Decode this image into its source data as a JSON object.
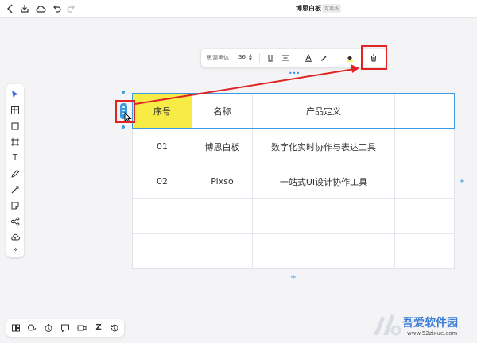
{
  "topbar": {
    "title": "博思白板",
    "badge": "可离线",
    "icons": [
      "back-icon",
      "save-download-icon",
      "cloud-icon",
      "undo-icon",
      "redo-icon"
    ]
  },
  "left_toolbar": {
    "items": [
      {
        "name": "select-tool",
        "icon": "cursor-icon"
      },
      {
        "name": "table-tool",
        "icon": "table-icon"
      },
      {
        "name": "rectangle-tool",
        "icon": "square-icon"
      },
      {
        "name": "frame-tool",
        "icon": "frame-icon"
      },
      {
        "name": "text-tool",
        "icon": "text-icon",
        "glyph": "T"
      },
      {
        "name": "pen-tool",
        "icon": "pen-icon"
      },
      {
        "name": "line-tool",
        "icon": "line-icon"
      },
      {
        "name": "sticky-note-tool",
        "icon": "sticky-note-icon"
      },
      {
        "name": "mindmap-tool",
        "icon": "mindmap-icon"
      },
      {
        "name": "upload-tool",
        "icon": "upload-icon"
      },
      {
        "name": "more-tool",
        "icon": "more-icon",
        "glyph": "»"
      }
    ]
  },
  "bottom_toolbar": {
    "items": [
      {
        "name": "layout-button",
        "icon": "layout-icon"
      },
      {
        "name": "chat-button",
        "icon": "chat-icon"
      },
      {
        "name": "timer-button",
        "icon": "timer-icon"
      },
      {
        "name": "comment-button",
        "icon": "comment-icon"
      },
      {
        "name": "video-button",
        "icon": "video-icon"
      },
      {
        "name": "sleep-button",
        "icon": "z-icon",
        "glyph": "Z"
      },
      {
        "name": "history-button",
        "icon": "history-icon"
      }
    ]
  },
  "float_toolbar": {
    "font_name": "思源黑体",
    "font_size": "36",
    "stepper_up": "▲",
    "stepper_down": "▼",
    "icons": [
      "text-style-icon",
      "align-icon",
      "text-color-icon",
      "highlight-icon",
      "fill-color-icon",
      "delete-icon"
    ],
    "more_handle": "•••",
    "fill_color": "#f7ec45"
  },
  "table": {
    "header_fill": "#f7ec45",
    "headers": [
      "序号",
      "名称",
      "产品定义",
      ""
    ],
    "rows": [
      [
        "01",
        "博思白板",
        "数字化实时协作与表达工具",
        ""
      ],
      [
        "02",
        "Pixso",
        "一站式UI设计协作工具",
        ""
      ],
      [
        "",
        "",
        "",
        ""
      ],
      [
        "",
        "",
        "",
        ""
      ]
    ]
  },
  "canvas_controls": {
    "add_column": "+",
    "add_row": "+"
  },
  "annotations": {
    "highlight_color": "#e02323",
    "selection_color": "#3b9ae1"
  },
  "watermark": {
    "title": "吾爱软件园",
    "url": "www.52zixue.com"
  }
}
